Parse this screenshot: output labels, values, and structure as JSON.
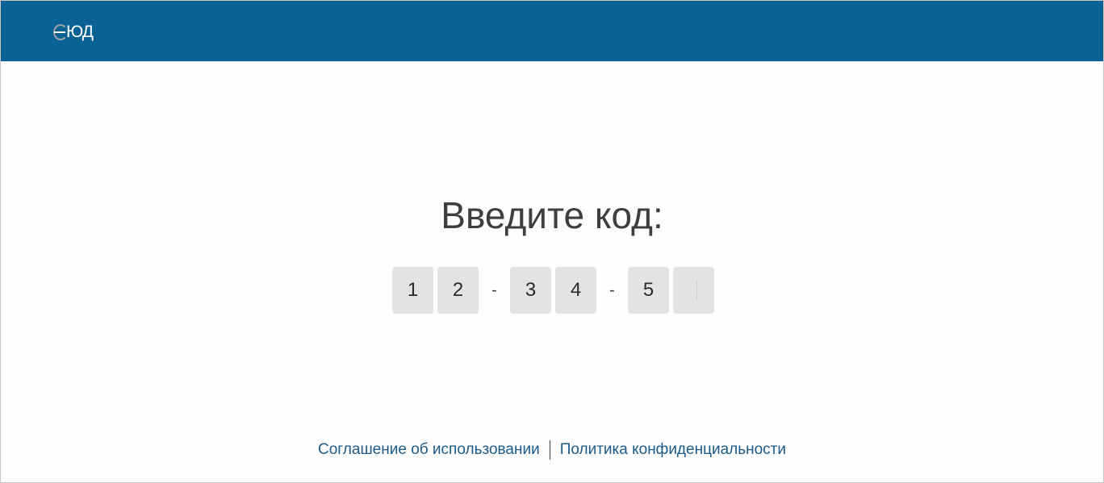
{
  "header": {
    "logo_text": "ЮД",
    "background_color": "#0a6193"
  },
  "main": {
    "title": "Введите код:",
    "code_digits": [
      "1",
      "2",
      "3",
      "4",
      "5",
      ""
    ],
    "separator": "-"
  },
  "footer": {
    "terms_link": "Соглашение об использовании",
    "privacy_link": "Политика конфиденциальности"
  }
}
